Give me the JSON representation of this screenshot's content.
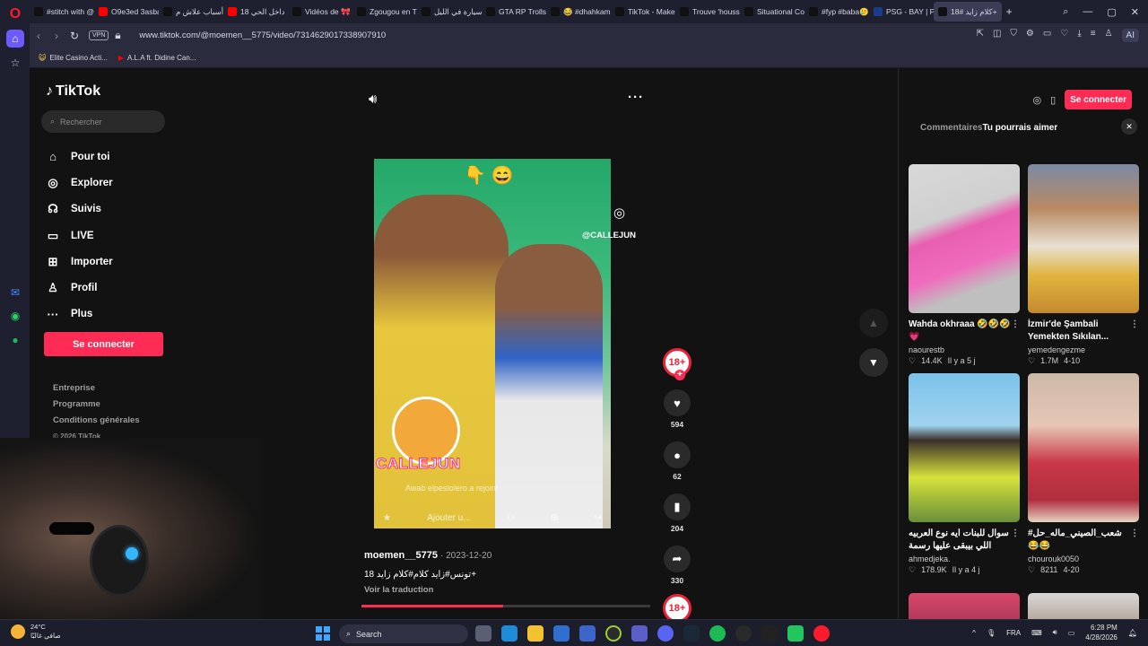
{
  "browser": {
    "tabs": [
      {
        "label": "#stitch with @",
        "color": "#111111"
      },
      {
        "label": "O9e3ed 3asba",
        "color": "#ff0000"
      },
      {
        "label": "أسباب علاش م",
        "color": "#111111"
      },
      {
        "label": "داخل الحي 18",
        "color": "#ff0000"
      },
      {
        "label": "Vidéos de 🎀",
        "color": "#111111"
      },
      {
        "label": "Zgougou en T",
        "color": "#111111"
      },
      {
        "label": "سيارة في الليل",
        "color": "#111111"
      },
      {
        "label": "GTA RP Trolls",
        "color": "#111111"
      },
      {
        "label": "😂 #dhahkam",
        "color": "#111111"
      },
      {
        "label": "TikTok - Make",
        "color": "#111111"
      },
      {
        "label": "Trouve 'housse",
        "color": "#111111"
      },
      {
        "label": "Situational Co",
        "color": "#111111"
      },
      {
        "label": "#fyp #baba🥲",
        "color": "#111111"
      },
      {
        "label": "PSG - BAY | PS",
        "color": "#1e3a8a"
      },
      {
        "label": "كلام زايد #18+",
        "color": "#111111",
        "active": true
      }
    ],
    "new_tab": "+",
    "vpn": "VPN",
    "url": "www.tiktok.com/@moemen__5775/video/7314629017338907910",
    "ai_label": "AI",
    "bookmarks": [
      "Elite Casino Acti...",
      "A.L.A ft. Didine Can..."
    ]
  },
  "tiktok": {
    "logo": "TikTok",
    "search_placeholder": "Rechercher",
    "nav": [
      {
        "icon": "home-icon",
        "glyph": "⌂",
        "label": "Pour toi"
      },
      {
        "icon": "compass-icon",
        "glyph": "◎",
        "label": "Explorer"
      },
      {
        "icon": "following-icon",
        "glyph": "☊",
        "label": "Suivis"
      },
      {
        "icon": "live-icon",
        "glyph": "▭",
        "label": "LIVE"
      },
      {
        "icon": "upload-icon",
        "glyph": "⊞",
        "label": "Importer"
      },
      {
        "icon": "profile-icon",
        "glyph": "♙",
        "label": "Profil"
      },
      {
        "icon": "more-icon",
        "glyph": "···",
        "label": "Plus"
      }
    ],
    "login": "Se connecter",
    "footer": [
      "Entreprise",
      "Programme",
      "Conditions générales"
    ],
    "copyright": "© 2026 TikTok",
    "video": {
      "emoji": "👇 😄",
      "ig_handle": "@CALLEJUN",
      "streamer_tag": "CALLEJUN",
      "join_text": "Awab elpestolero a rejoint",
      "bottom_bar": "Ajouter u...",
      "progress": 0.49
    },
    "meta": {
      "author": "moemen__5775",
      "date": "2023-12-20",
      "caption": "تونس#زايد كلام#كلام زايد 18+",
      "translate": "Voir la traduction"
    },
    "actions": {
      "avatar": "18+",
      "likes": "594",
      "comments": "62",
      "saves": "204",
      "shares": "330"
    },
    "right_panel": {
      "login": "Se connecter",
      "tab_comments": "Commentaires",
      "tab_suggest": "Tu pourrais aimer",
      "cards": [
        {
          "title": "Wahda okhraaa 🤣🤣🤣💗",
          "author": "naourestb",
          "views": "14.4K",
          "age": "Il y a 5 j",
          "thumb": "t1"
        },
        {
          "title": "İzmir'de Şambali Yemekten Sıkılan...",
          "author": "yemedengezme",
          "views": "1.7M",
          "age": "4-10",
          "thumb": "t2"
        },
        {
          "title": "سوال للبنات ايه نوع العربيه اللي بيبقى عليها رسمة حصان بيجري",
          "author": "ahmedjeka.",
          "views": "178.9K",
          "age": "Il y a 4 j",
          "thumb": "t3"
        },
        {
          "title": "شعب_الصيني_ماله_حل# 😂😂 #القيروان_ام_المدائن 😂 TN#",
          "author": "chourouk0050",
          "views": "8211",
          "age": "4-20",
          "thumb": "t4"
        }
      ]
    }
  },
  "taskbar": {
    "temp": "24°C",
    "weather": "صافي غالبًا",
    "search": "Search",
    "lang": "FRA",
    "time": "6:28 PM",
    "date": "4/28/2026"
  }
}
